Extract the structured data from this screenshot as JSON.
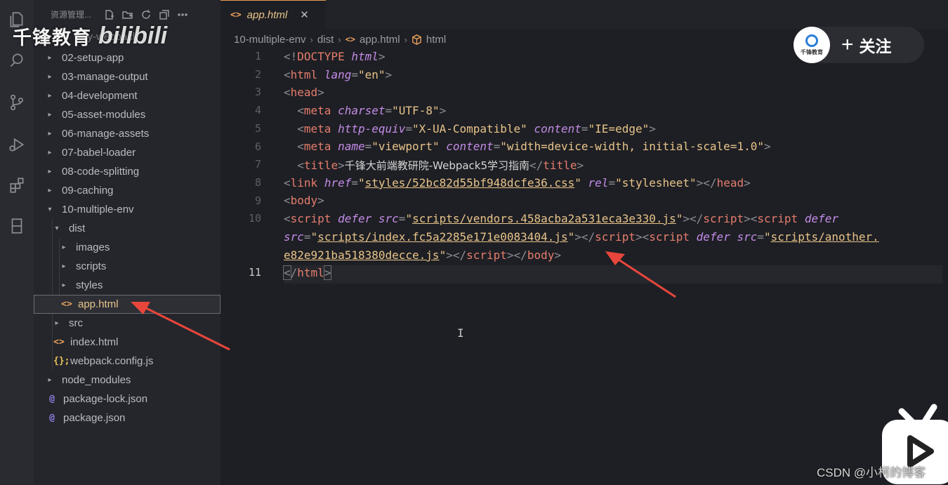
{
  "sidebar": {
    "header": "资源管理...",
    "partial_folder": "my-webpack",
    "items": [
      {
        "label": "02-setup-app",
        "type": "folder",
        "expanded": false
      },
      {
        "label": "03-manage-output",
        "type": "folder",
        "expanded": false
      },
      {
        "label": "04-development",
        "type": "folder",
        "expanded": false
      },
      {
        "label": "05-asset-modules",
        "type": "folder",
        "expanded": false
      },
      {
        "label": "06-manage-assets",
        "type": "folder",
        "expanded": false
      },
      {
        "label": "07-babel-loader",
        "type": "folder",
        "expanded": false
      },
      {
        "label": "08-code-splitting",
        "type": "folder",
        "expanded": false
      },
      {
        "label": "09-caching",
        "type": "folder",
        "expanded": false
      },
      {
        "label": "10-multiple-env",
        "type": "folder",
        "expanded": true
      },
      {
        "label": "dist",
        "type": "folder",
        "expanded": true
      },
      {
        "label": "images",
        "type": "folder",
        "expanded": false
      },
      {
        "label": "scripts",
        "type": "folder",
        "expanded": false
      },
      {
        "label": "styles",
        "type": "folder",
        "expanded": false
      },
      {
        "label": "app.html",
        "type": "html",
        "selected": true
      },
      {
        "label": "src",
        "type": "folder",
        "expanded": false
      },
      {
        "label": "index.html",
        "type": "html"
      },
      {
        "label": "webpack.config.js",
        "type": "js"
      },
      {
        "label": "node_modules",
        "type": "folder",
        "expanded": false
      },
      {
        "label": "package-lock.json",
        "type": "json"
      },
      {
        "label": "package.json",
        "type": "json"
      }
    ]
  },
  "icons": {
    "html": "<>",
    "js": "{};",
    "json": "@"
  },
  "tab": {
    "name": "app.html",
    "close": "✕"
  },
  "breadcrumb": {
    "parts": [
      "10-multiple-env",
      "dist",
      "app.html",
      "html"
    ]
  },
  "code": {
    "line_numbers": [
      "1",
      "2",
      "3",
      "4",
      "5",
      "6",
      "7",
      "8",
      "9",
      "10",
      "",
      "",
      "11"
    ],
    "line_1": {
      "a": "<!",
      "b": "DOCTYPE",
      "c": "html",
      "d": ">"
    },
    "line_2": {
      "tag": "html",
      "attr": "lang",
      "val": "\"en\""
    },
    "line_3": {
      "tag": "head"
    },
    "line_4": {
      "tag": "meta",
      "attr": "charset",
      "val": "\"UTF-8\""
    },
    "line_5": {
      "tag": "meta",
      "attr1": "http-equiv",
      "val1": "\"X-UA-Compatible\"",
      "attr2": "content",
      "val2": "\"IE=edge\""
    },
    "line_6": {
      "tag": "meta",
      "attr1": "name",
      "val1": "\"viewport\"",
      "attr2": "content",
      "val2": "\"width=device-width, initial-scale=1.0\""
    },
    "line_7": {
      "tag": "title",
      "text": "千锋大前端教研院-Webpack5学习指南",
      "close": "title"
    },
    "line_8": {
      "tag": "link",
      "attr1": "href",
      "val1": "styles/52bc82d55bf948dcfe36.css",
      "attr2": "rel",
      "val2": "\"stylesheet\"",
      "close": "head"
    },
    "line_9": {
      "tag": "body"
    },
    "line_10a": {
      "tag": "script",
      "kw": "defer",
      "attr": "src",
      "val": "scripts/vendors.458acba2a531eca3e330.js",
      "close": "script",
      "tag2": "script",
      "kw2": "defer"
    },
    "line_10b": {
      "attr": "src",
      "val": "scripts/index.fc5a2285e171e0083404.js",
      "close": "script",
      "tag2": "script",
      "kw2": "defer",
      "attr2": "src",
      "val2": "scripts/another."
    },
    "line_10c": {
      "val": "e82e921ba518380decce.js",
      "close1": "script",
      "close2": "body"
    },
    "line_11": {
      "tag": "html"
    }
  },
  "cursor_glyph": "I",
  "overlay": {
    "brand_text": "千锋教育",
    "bili_text": "bilibili",
    "follow_logo_text": "千锋教育",
    "follow_plus": "+",
    "follow_label": "关注",
    "csdn_watermark": "CSDN @小柯的博客"
  },
  "colors": {
    "accent_orange": "#e8a15c",
    "arrow_red": "#e8463c",
    "tag": "#e57d6d",
    "attr": "#c48ce8",
    "string": "#e8c48a"
  }
}
